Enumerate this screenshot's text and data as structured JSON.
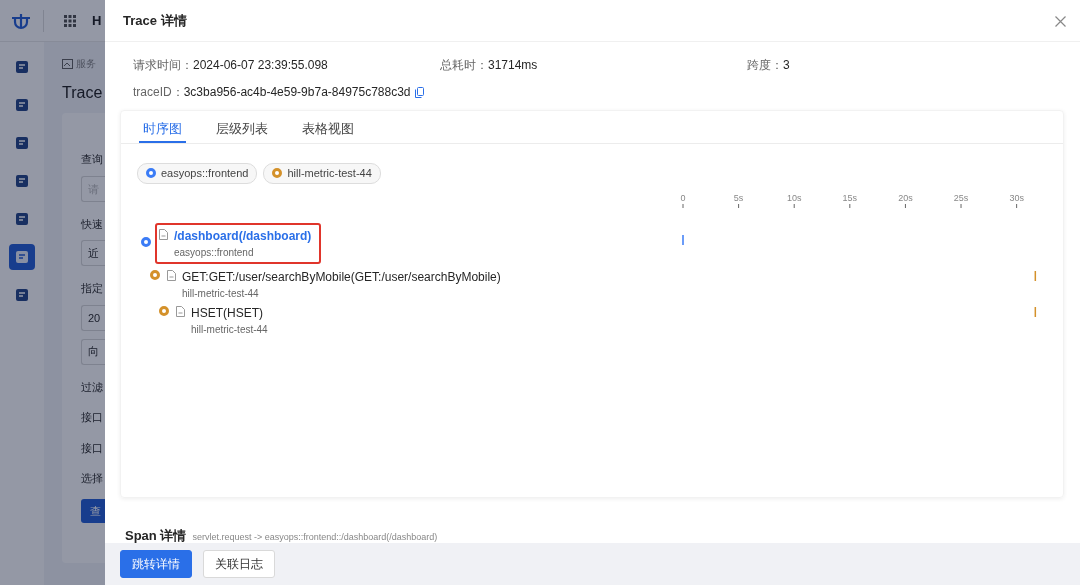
{
  "background": {
    "topbar": {
      "initial": "H"
    },
    "sidebar": {
      "items": [
        {
          "selected": false
        },
        {
          "selected": false
        },
        {
          "selected": false
        },
        {
          "selected": false
        },
        {
          "selected": false
        },
        {
          "selected": true
        },
        {
          "selected": false
        }
      ]
    },
    "breadcrumb": "服务",
    "title": "Trace",
    "form": [
      {
        "kind": "label",
        "text": "查询"
      },
      {
        "kind": "field",
        "placeholder": "请"
      },
      {
        "kind": "label",
        "text": "快速"
      },
      {
        "kind": "field",
        "value": "近"
      },
      {
        "kind": "label",
        "text": "指定"
      },
      {
        "kind": "field",
        "value": "20"
      },
      {
        "kind": "field",
        "value": "向"
      },
      {
        "kind": "label",
        "text": "过滤"
      },
      {
        "kind": "label",
        "text": "接口"
      },
      {
        "kind": "label",
        "text": "接口"
      },
      {
        "kind": "label",
        "text": "选择"
      }
    ],
    "button": "查"
  },
  "drawer": {
    "title": "Trace 详情",
    "info": [
      {
        "label": "请求时间：",
        "value": "2024-06-07 23:39:55.098"
      },
      {
        "label": "总耗时：",
        "value": "31714ms"
      },
      {
        "label": "跨度：",
        "value": "3"
      }
    ],
    "trace_id": {
      "label": "traceID：",
      "value": "3c3ba956-ac4b-4e59-9b7a-84975c788c3d"
    },
    "tabs": [
      {
        "label": "时序图",
        "selected": true
      },
      {
        "label": "层级列表",
        "selected": false
      },
      {
        "label": "表格视图",
        "selected": false
      }
    ],
    "services": [
      {
        "name": "easyops::frontend",
        "color": "#3b7cf6"
      },
      {
        "name": "hill-metric-test-44",
        "color": "#d4912a"
      }
    ],
    "timeline_ticks": [
      "0",
      "5s",
      "10s",
      "15s",
      "20s",
      "25s",
      "30s"
    ],
    "spans": [
      {
        "title": "/dashboard(/dashboard)",
        "service": "easyops::frontend",
        "color": "#3b7cf6",
        "selected": true,
        "level": 0,
        "children": [
          {
            "title": "GET:GET:/user/searchByMobile(GET:/user/searchByMobile)",
            "service": "hill-metric-test-44",
            "color": "#d4912a",
            "selected": false,
            "level": 0.96,
            "children": [
              {
                "title": "HSET(HSET)",
                "service": "hill-metric-test-44",
                "color": "#d4912a",
                "selected": false,
                "level": 0.96
              }
            ]
          }
        ]
      }
    ],
    "span_detail": {
      "title": "Span 详情",
      "subtitle": "servlet.request -> easyops::frontend::/dashboard(/dashboard)"
    },
    "buttons": [
      {
        "label": "跳转详情",
        "kind": "primary"
      },
      {
        "label": "关联日志",
        "kind": "default"
      }
    ]
  }
}
